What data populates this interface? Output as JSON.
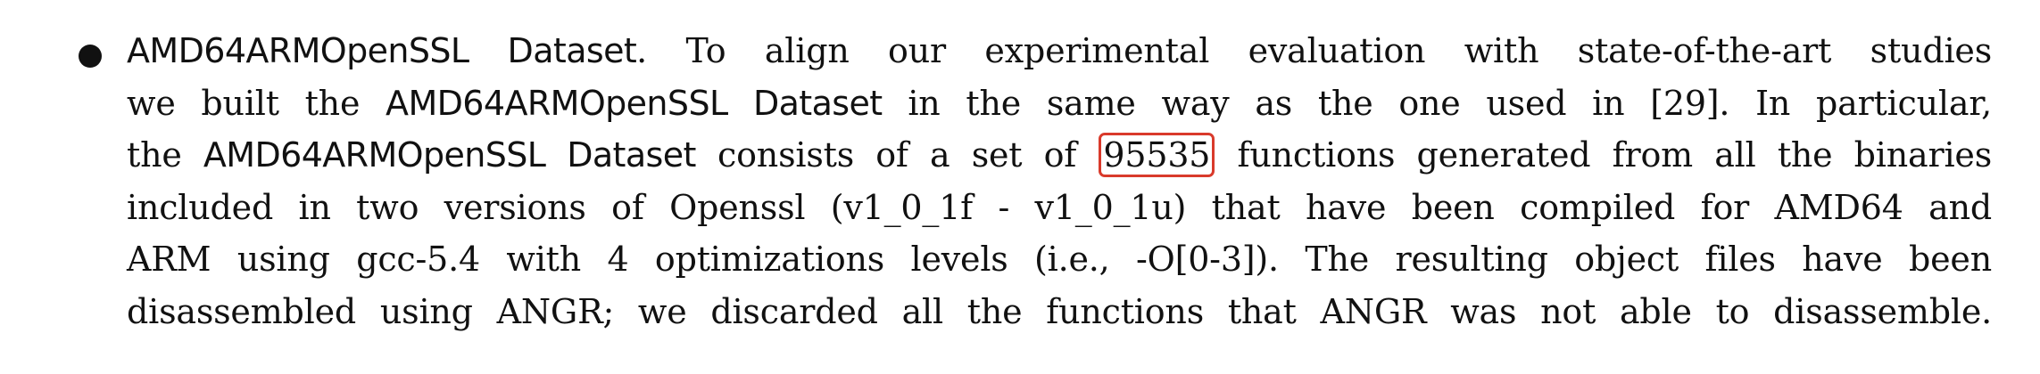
{
  "item": {
    "title": "AMD64ARMOpenSSL Dataset",
    "title_period": ".",
    "line1_rest": " To align our experimental evaluation with state-of-the-art studies",
    "line2_a": "we built the ",
    "line2_b": "AMD64ARMOpenSSL Dataset",
    "line2_c": " in the same way as the one used in [29]. In particular,",
    "line3_a": "the ",
    "line3_b": "AMD64ARMOpenSSL Dataset",
    "line3_c": " consists of a set of ",
    "highlighted_number": "95535",
    "line3_d": " functions generated from all the binaries",
    "line4": "included in two versions of Openssl (v1_0_1f - v1_0_1u) that have been compiled for AMD64 and",
    "line5": "ARM using gcc-5.4 with 4 optimizations levels (i.e., -O[0-3]). The resulting object files have been",
    "line6": "disassembled using ANGR; we discarded all the functions that ANGR was not able to disassemble."
  },
  "colors": {
    "text": "#111111",
    "highlight_border": "#d93a2b",
    "background": "#ffffff"
  }
}
